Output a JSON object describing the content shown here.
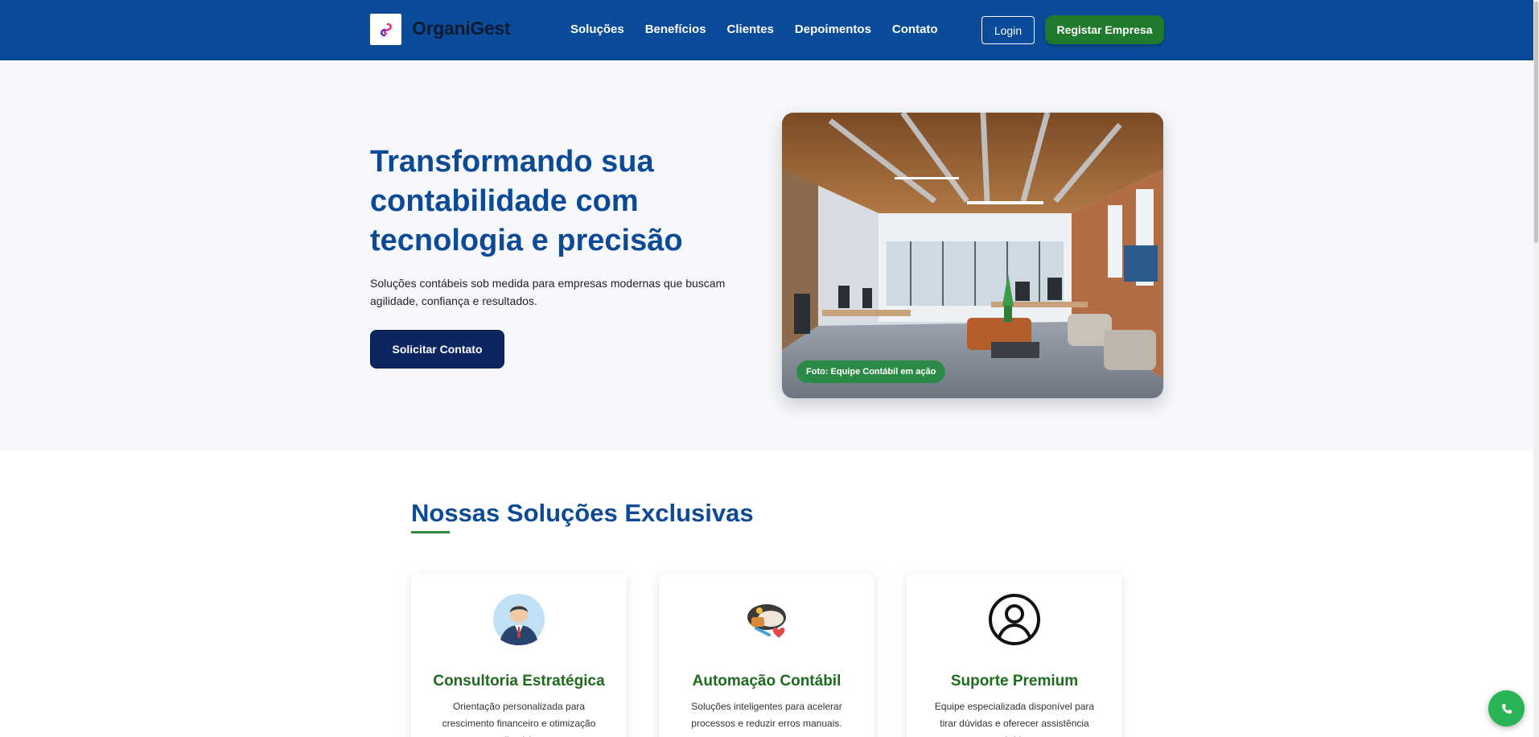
{
  "header": {
    "brand": "OrganiGest",
    "nav": [
      "Soluções",
      "Benefícios",
      "Clientes",
      "Depoimentos",
      "Contato"
    ],
    "login_label": "Login",
    "register_label": "Registar Empresa"
  },
  "hero": {
    "title": "Transformando sua contabilidade com tecnologia e precisão",
    "subtitle": "Soluções contábeis sob medida para empresas modernas que buscam agilidade, confiança e resultados.",
    "cta_label": "Solicitar Contato",
    "photo_caption": "Foto: Equipe Contábil em ação"
  },
  "solutions": {
    "title": "Nossas Soluções Exclusivas",
    "cards": [
      {
        "icon": "consultant-avatar-icon",
        "title": "Consultoria Estratégica",
        "text": "Orientação personalizada para crescimento financeiro e otimização tributária."
      },
      {
        "icon": "automation-illustration-icon",
        "title": "Automação Contábil",
        "text": "Soluções inteligentes para acelerar processos e reduzir erros manuais."
      },
      {
        "icon": "user-circle-icon",
        "title": "Suporte Premium",
        "text": "Equipe especializada disponível para tirar dúvidas e oferecer assistência rápida."
      }
    ]
  },
  "colors": {
    "header_bg": "#0a4c9a",
    "accent_green": "#1f7a2e",
    "title_blue": "#0d4a96",
    "cta_navy": "#0b2660",
    "whatsapp_green": "#29b455"
  },
  "floating": {
    "icon": "phone-icon"
  }
}
